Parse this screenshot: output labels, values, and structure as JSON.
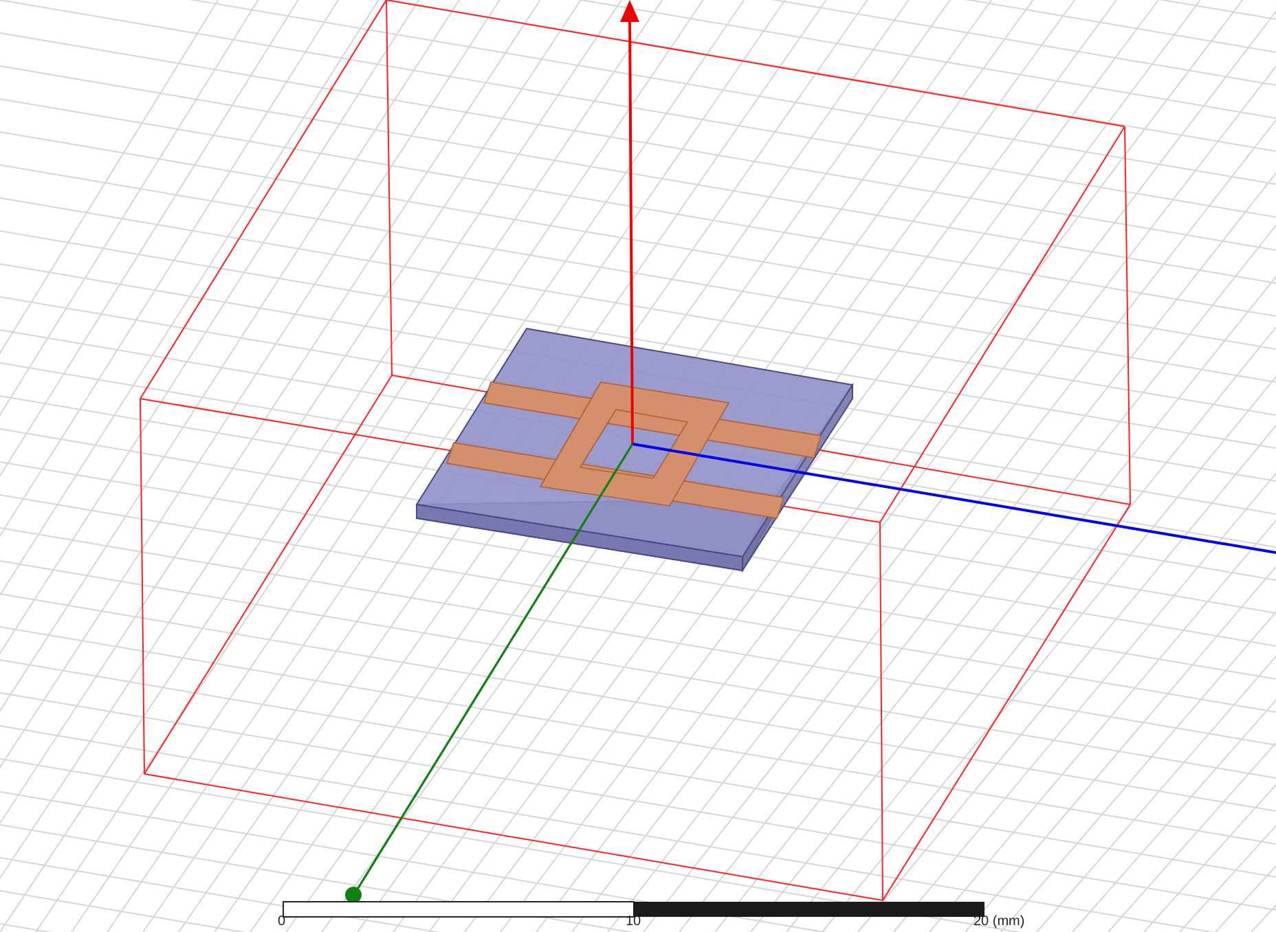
{
  "scale_bar": {
    "labels": [
      "0",
      "10",
      "20 (mm)"
    ]
  }
}
